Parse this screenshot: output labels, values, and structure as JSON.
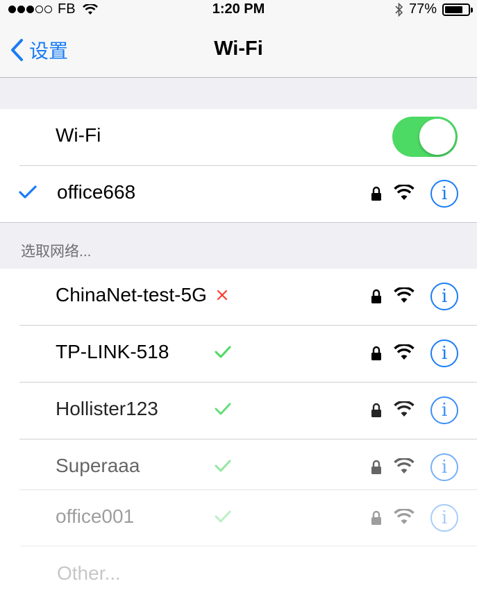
{
  "statusbar": {
    "carrier": "FB",
    "time": "1:20 PM",
    "battery": "77%",
    "battery_level": 0.77
  },
  "nav": {
    "back_label": "设置",
    "title": "Wi-Fi"
  },
  "wifi_toggle": {
    "label": "Wi-Fi",
    "on": true
  },
  "connected": {
    "name": "office668"
  },
  "section_header": "选取网络...",
  "networks": [
    {
      "name": "ChinaNet-test-5G",
      "status": "fail"
    },
    {
      "name": "TP-LINK-518",
      "status": "ok"
    },
    {
      "name": "Hollister123",
      "status": "ok"
    },
    {
      "name": "Superaaa",
      "status": "ok"
    },
    {
      "name": "office001",
      "status": "ok"
    }
  ],
  "other_label": "Other...",
  "colors": {
    "accent": "#1a7cf5",
    "toggle_on": "#4cd964",
    "fail": "#ff3b30",
    "ok": "#4cd964"
  }
}
